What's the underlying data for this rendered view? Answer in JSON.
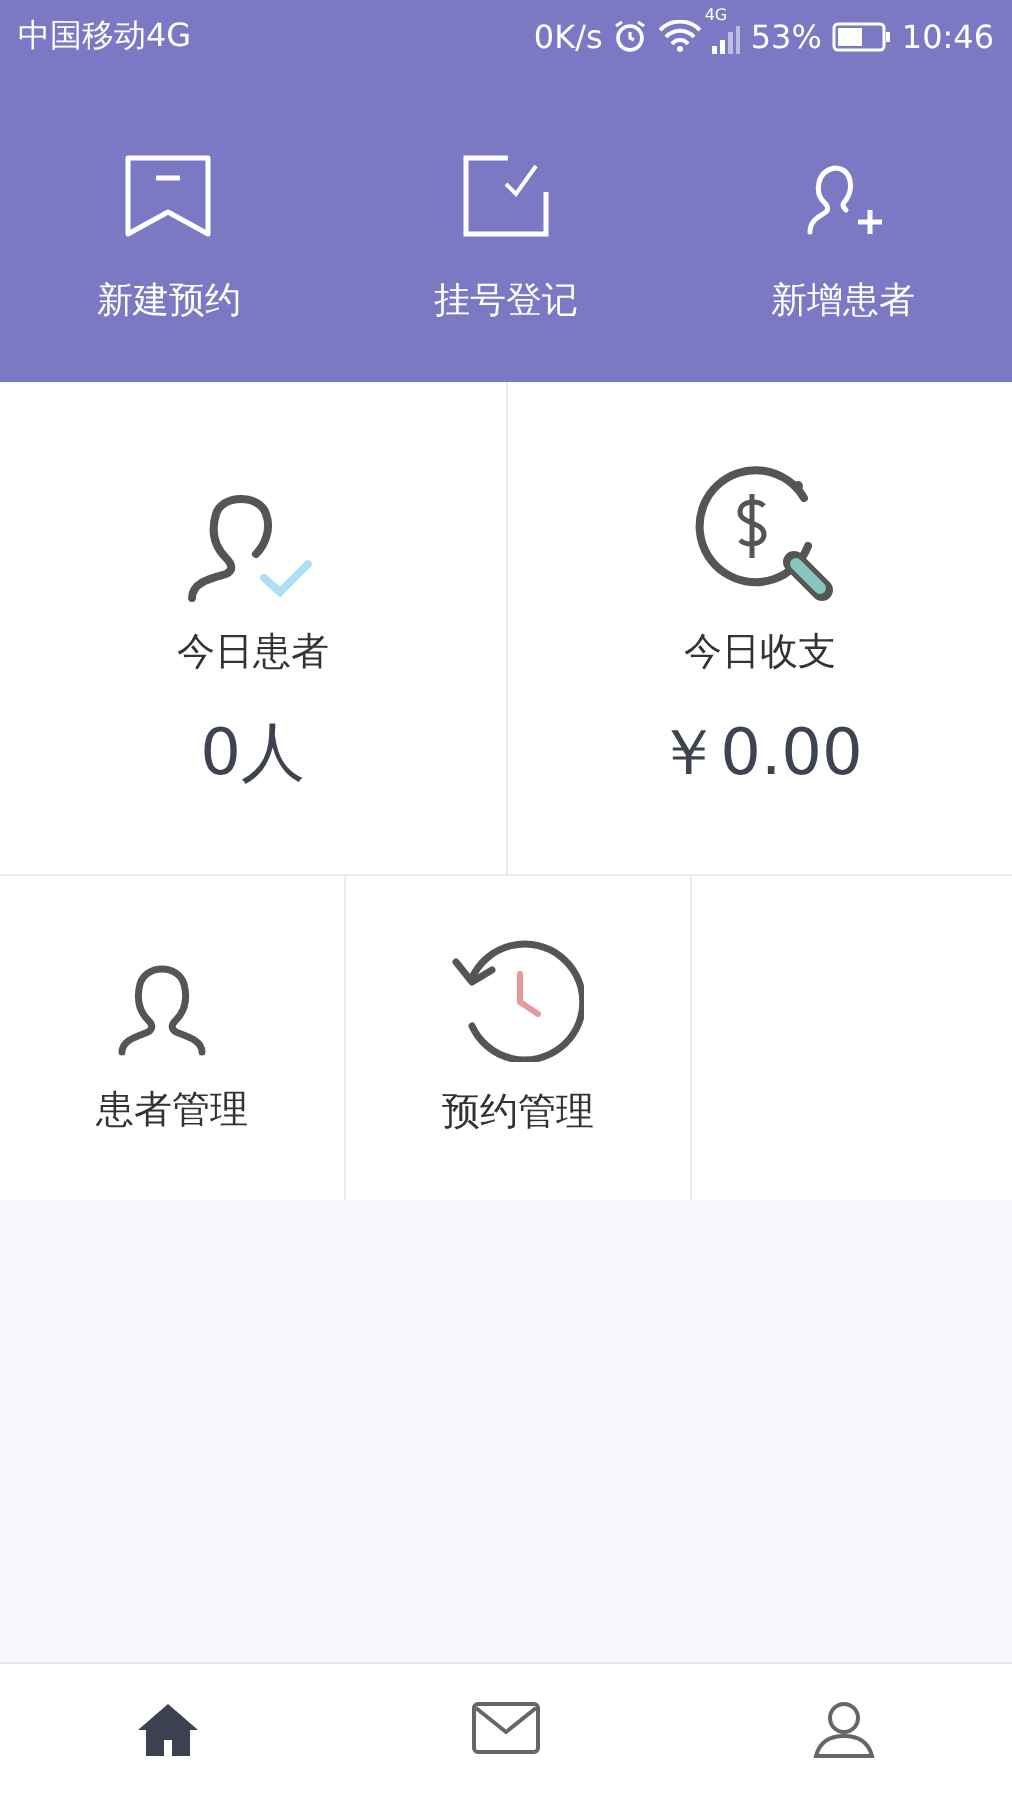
{
  "status_bar": {
    "carrier": "中国移动4G",
    "speed": "0K/s",
    "network": "4G",
    "battery": "53%",
    "time": "10:46"
  },
  "quick_actions": [
    {
      "kind": "bookmark",
      "label": "新建预约"
    },
    {
      "kind": "checkbox",
      "label": "挂号登记"
    },
    {
      "kind": "add-person",
      "label": "新增患者"
    }
  ],
  "stats": [
    {
      "kind": "patients",
      "label": "今日患者",
      "value": "0人"
    },
    {
      "kind": "money",
      "label": "今日收支",
      "value": "￥0.00"
    }
  ],
  "modules": [
    {
      "kind": "person",
      "label": "患者管理"
    },
    {
      "kind": "history",
      "label": "预约管理"
    }
  ],
  "bottom_nav": [
    {
      "kind": "home",
      "selected": true
    },
    {
      "kind": "mail",
      "selected": false
    },
    {
      "kind": "person",
      "selected": false
    }
  ]
}
